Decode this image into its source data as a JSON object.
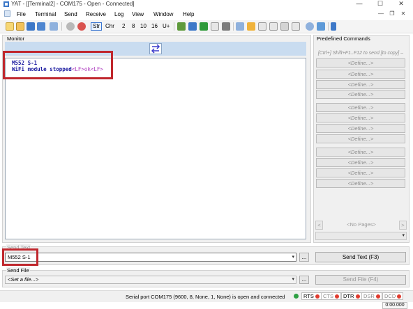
{
  "window": {
    "title": "YAT - [[Terminal2] - COM175 - Open - Connected]",
    "controls": [
      "—",
      "☐",
      "✕"
    ]
  },
  "menu": {
    "items": [
      "File",
      "Terminal",
      "Send",
      "Receive",
      "Log",
      "View",
      "Window",
      "Help"
    ],
    "child_controls": [
      "—",
      "❐",
      "✕"
    ]
  },
  "toolbar": {
    "radix": [
      "Str",
      "Chr",
      "2",
      "8",
      "10",
      "16",
      "U+"
    ],
    "active_radix": "Str",
    "colors": {
      "blue": "#3d78c8",
      "red": "#d9534f",
      "green": "#2f9a3a",
      "gray": "#9a9a9a"
    }
  },
  "monitor": {
    "label": "Monitor",
    "lines": [
      {
        "text": "M552 S-1",
        "suffix": ""
      },
      {
        "text": "WiFi module stopped",
        "suffix": "<LF>ok<LF>"
      }
    ]
  },
  "predefined": {
    "label": "Predefined Commands",
    "hint": "[Ctrl+] Shift+F1..F12 to send [to copy] –",
    "define_label": "<Define...>",
    "pager": {
      "prev": "<",
      "label": "<No Pages>",
      "next": ">"
    }
  },
  "send_text": {
    "label": "Send Text",
    "value": "M552 S-1",
    "ellipsis": "...",
    "button": "Send Text (F3)"
  },
  "send_file": {
    "label": "Send File",
    "value": "<Set a file...>",
    "ellipsis": "...",
    "button": "Send File (F4)"
  },
  "status": {
    "message": "Serial port COM175 (9600, 8, None, 1, None) is open and connected",
    "signals": [
      {
        "name": "RTS",
        "state": "on"
      },
      {
        "name": "CTS",
        "state": "off"
      },
      {
        "name": "DTR",
        "state": "on"
      },
      {
        "name": "DSR",
        "state": "off"
      },
      {
        "name": "DCD",
        "state": "off"
      }
    ],
    "connection_led": "#2ea043",
    "signal_led": "#e03b2e",
    "timer": "0:00.000"
  }
}
